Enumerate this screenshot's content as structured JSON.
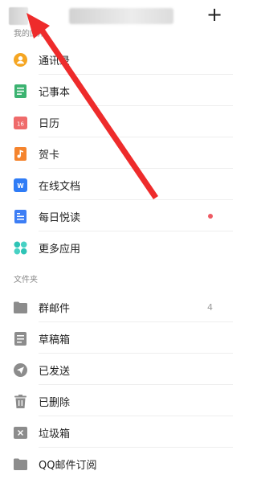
{
  "header": {
    "add_label": "+"
  },
  "sections": {
    "my_apps_label": "我的应用",
    "folders_label": "文件夹"
  },
  "apps": [
    {
      "label": "通讯录",
      "icon": "contacts-icon",
      "color": "#f5a623"
    },
    {
      "label": "记事本",
      "icon": "notebook-icon",
      "color": "#3cb371"
    },
    {
      "label": "日历",
      "icon": "calendar-icon",
      "color": "#ef6b6b",
      "icon_text": "16"
    },
    {
      "label": "贺卡",
      "icon": "greeting-card-icon",
      "color": "#f5842d"
    },
    {
      "label": "在线文档",
      "icon": "online-doc-icon",
      "color": "#2f7cf6",
      "icon_text": "W"
    },
    {
      "label": "每日悦读",
      "icon": "daily-read-icon",
      "color": "#3d7ef5",
      "has_dot": true
    },
    {
      "label": "更多应用",
      "icon": "more-apps-icon",
      "color": "#2ec4b6"
    }
  ],
  "folders": [
    {
      "label": "群邮件",
      "icon": "group-mail-icon",
      "count": "4"
    },
    {
      "label": "草稿箱",
      "icon": "drafts-icon"
    },
    {
      "label": "已发送",
      "icon": "sent-icon"
    },
    {
      "label": "已删除",
      "icon": "trash-icon"
    },
    {
      "label": "垃圾箱",
      "icon": "spam-icon"
    },
    {
      "label": "QQ邮件订阅",
      "icon": "subscription-icon"
    }
  ],
  "colors": {
    "annotation_arrow": "#ee2b2b",
    "badge_dot": "#ee5a63",
    "folder_icon": "#8c8c8c"
  }
}
